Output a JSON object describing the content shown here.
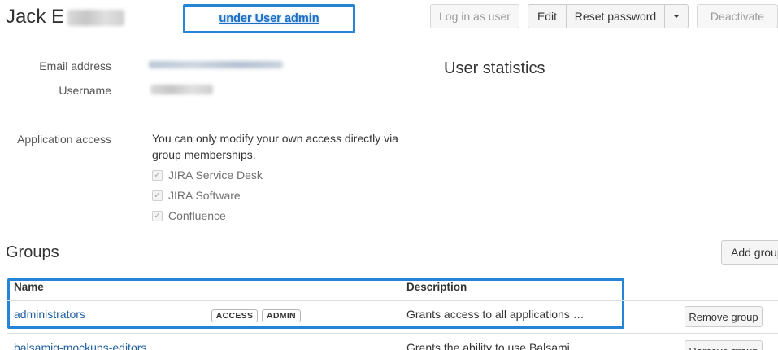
{
  "user": {
    "name_prefix": "Jack E"
  },
  "annotation": {
    "note": "under User admin",
    "color": "#2684d6"
  },
  "header_actions": {
    "login_as_user": "Log in as user",
    "edit": "Edit",
    "reset_password": "Reset password",
    "deactivate": "Deactivate"
  },
  "details": {
    "email_label": "Email address",
    "username_label": "Username",
    "application_access_label": "Application access",
    "application_access_text": "You can only modify your own access directly via group memberships.",
    "applications": [
      {
        "name": "JIRA Service Desk",
        "checked": true
      },
      {
        "name": "JIRA Software",
        "checked": true
      },
      {
        "name": "Confluence",
        "checked": true
      }
    ]
  },
  "stats": {
    "title": "User statistics"
  },
  "groups": {
    "title": "Groups",
    "add_button": "Add group",
    "columns": {
      "name": "Name",
      "description": "Description"
    },
    "rows": [
      {
        "name": "administrators",
        "badges": [
          "ACCESS",
          "ADMIN"
        ],
        "description": "Grants access to all applications …",
        "action": "Remove group"
      },
      {
        "name": "balsamiq-mockups-editors",
        "badges": [],
        "description": "Grants the ability to use Balsami",
        "action": "Remove group"
      }
    ]
  },
  "colors": {
    "link": "#2060a0",
    "annotation": "#2684d6"
  }
}
